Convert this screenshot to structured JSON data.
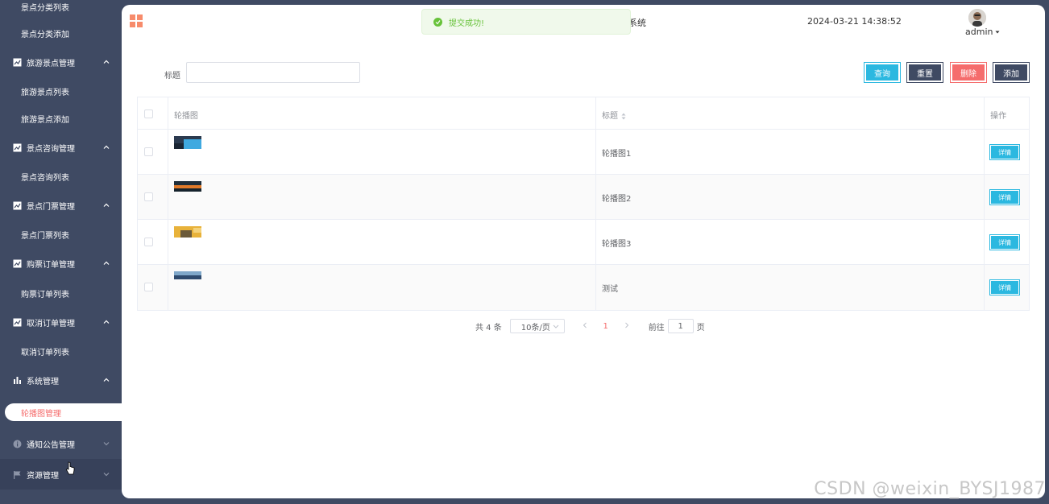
{
  "sidebar": {
    "items": [
      {
        "label": "景点分类列表"
      },
      {
        "label": "景点分类添加"
      },
      {
        "label": "旅游景点管理"
      },
      {
        "label": "旅游景点列表"
      },
      {
        "label": "旅游景点添加"
      },
      {
        "label": "景点咨询管理"
      },
      {
        "label": "景点咨询列表"
      },
      {
        "label": "景点门票管理"
      },
      {
        "label": "景点门票列表"
      },
      {
        "label": "购票订单管理"
      },
      {
        "label": "购票订单列表"
      },
      {
        "label": "取消订单管理"
      },
      {
        "label": "取消订单列表"
      },
      {
        "label": "系统管理"
      },
      {
        "label": "轮播图管理"
      },
      {
        "label": "通知公告管理"
      },
      {
        "label": "资源管理"
      }
    ]
  },
  "header": {
    "system_name": "系统",
    "datetime": "2024-03-21 14:38:52",
    "user": "admin"
  },
  "toast": {
    "message": "提交成功!"
  },
  "search": {
    "label": "标题",
    "value": ""
  },
  "toolbar": {
    "query": "查询",
    "reset": "重置",
    "delete": "删除",
    "add": "添加"
  },
  "table": {
    "headers": [
      "轮播图",
      "标题",
      "操作"
    ],
    "rows": [
      {
        "title": "轮播图1",
        "action": "详情",
        "thumb_colors": [
          "#2b3a4f",
          "#3fa9e0"
        ]
      },
      {
        "title": "轮播图2",
        "action": "详情",
        "thumb_colors": [
          "#1f2e3a",
          "#e07a2a"
        ]
      },
      {
        "title": "轮播图3",
        "action": "详情",
        "thumb_colors": [
          "#e8b23a",
          "#6b5a3a"
        ]
      },
      {
        "title": "测试",
        "action": "详情",
        "thumb_colors": [
          "#7fa7c9",
          "#2e4a6e"
        ]
      }
    ]
  },
  "pagination": {
    "total": "共 4 条",
    "page_size": "10条/页",
    "current_page": "1",
    "goto_prefix": "前往",
    "goto_value": "1",
    "goto_suffix": "页"
  },
  "watermark": "CSDN @weixin_BYSJ1987",
  "colors": {
    "sidebar_bg": "#3f4a63",
    "accent": "#2bb8e0",
    "danger": "#f56c6c",
    "success": "#67c23a"
  }
}
